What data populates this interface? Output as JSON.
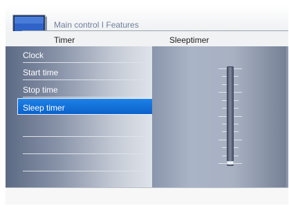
{
  "header": {
    "breadcrumb": "Main control I Features",
    "icon": "tv-icon"
  },
  "columns": {
    "left": "Timer",
    "right": "Sleeptimer"
  },
  "menu": {
    "items": [
      {
        "label": "Clock",
        "selected": false
      },
      {
        "label": "Start time",
        "selected": false
      },
      {
        "label": "Stop time",
        "selected": false
      },
      {
        "label": "Sleep timer",
        "selected": true
      },
      {
        "label": "",
        "selected": false
      },
      {
        "label": "",
        "selected": false
      },
      {
        "label": "",
        "selected": false
      },
      {
        "label": "",
        "selected": false
      }
    ]
  },
  "sleeptimer": {
    "level_fraction": 0.0
  },
  "colors": {
    "selection": "#0b61c9",
    "panel_dark": "#5c6a84",
    "panel_light": "#dfe3ea"
  }
}
